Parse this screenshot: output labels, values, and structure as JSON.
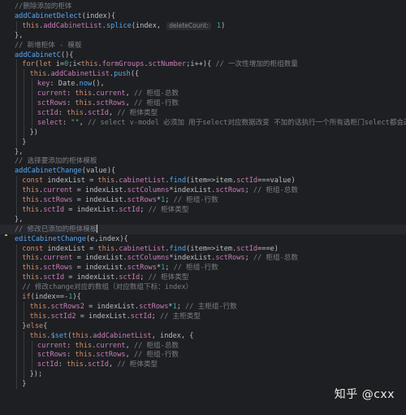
{
  "lines": [
    {
      "indent": 1,
      "tokens": [
        {
          "t": "//删除添加的柜体",
          "c": "cm"
        }
      ]
    },
    {
      "indent": 1,
      "tokens": [
        {
          "t": "addCabinetDelect",
          "c": "fn"
        },
        {
          "t": "(index){",
          "c": "plain"
        }
      ]
    },
    {
      "indent": 2,
      "tokens": [
        {
          "t": "this",
          "c": "kw"
        },
        {
          "t": ".",
          "c": "plain"
        },
        {
          "t": "addCabinetList",
          "c": "prop"
        },
        {
          "t": ".",
          "c": "plain"
        },
        {
          "t": "splice",
          "c": "fn"
        },
        {
          "t": "(index, ",
          "c": "plain"
        },
        {
          "t": "deleteCount:",
          "c": "hint"
        },
        {
          "t": " 1",
          "c": "num"
        },
        {
          "t": ")",
          "c": "plain"
        }
      ]
    },
    {
      "indent": 1,
      "tokens": [
        {
          "t": "},",
          "c": "plain"
        }
      ]
    },
    {
      "indent": 1,
      "tokens": [
        {
          "t": "// 新增柜体 - 模板",
          "c": "cm"
        }
      ]
    },
    {
      "indent": 1,
      "tokens": [
        {
          "t": "addCabinetC",
          "c": "fn"
        },
        {
          "t": "(){",
          "c": "plain"
        }
      ]
    },
    {
      "indent": 2,
      "tokens": [
        {
          "t": "for",
          "c": "kw"
        },
        {
          "t": "(",
          "c": "plain"
        },
        {
          "t": "let ",
          "c": "kw"
        },
        {
          "t": "i=",
          "c": "plain"
        },
        {
          "t": "0",
          "c": "num"
        },
        {
          "t": ";i<",
          "c": "plain"
        },
        {
          "t": "this",
          "c": "kw"
        },
        {
          "t": ".",
          "c": "plain"
        },
        {
          "t": "formGroups",
          "c": "prop"
        },
        {
          "t": ".",
          "c": "plain"
        },
        {
          "t": "sctNumber",
          "c": "prop"
        },
        {
          "t": ";i++){ ",
          "c": "plain"
        },
        {
          "t": "// 一次性增加的柜组数量",
          "c": "cm"
        }
      ]
    },
    {
      "indent": 3,
      "tokens": [
        {
          "t": "this",
          "c": "kw"
        },
        {
          "t": ".",
          "c": "plain"
        },
        {
          "t": "addCabinetList",
          "c": "prop"
        },
        {
          "t": ".",
          "c": "plain"
        },
        {
          "t": "push",
          "c": "fn"
        },
        {
          "t": "({",
          "c": "plain"
        }
      ]
    },
    {
      "indent": 4,
      "tokens": [
        {
          "t": "key",
          "c": "prop"
        },
        {
          "t": ": Date.",
          "c": "plain"
        },
        {
          "t": "now",
          "c": "fn"
        },
        {
          "t": "(),",
          "c": "plain"
        }
      ]
    },
    {
      "indent": 4,
      "tokens": [
        {
          "t": "current",
          "c": "prop"
        },
        {
          "t": ": ",
          "c": "plain"
        },
        {
          "t": "this",
          "c": "kw"
        },
        {
          "t": ".",
          "c": "plain"
        },
        {
          "t": "current",
          "c": "prop"
        },
        {
          "t": ", ",
          "c": "plain"
        },
        {
          "t": "// 柜组-总数",
          "c": "cm"
        }
      ]
    },
    {
      "indent": 4,
      "tokens": [
        {
          "t": "sctRows",
          "c": "prop"
        },
        {
          "t": ": ",
          "c": "plain"
        },
        {
          "t": "this",
          "c": "kw"
        },
        {
          "t": ".",
          "c": "plain"
        },
        {
          "t": "sctRows",
          "c": "prop"
        },
        {
          "t": ", ",
          "c": "plain"
        },
        {
          "t": "// 柜组-行数",
          "c": "cm"
        }
      ]
    },
    {
      "indent": 4,
      "tokens": [
        {
          "t": "sctId",
          "c": "prop"
        },
        {
          "t": ": ",
          "c": "plain"
        },
        {
          "t": "this",
          "c": "kw"
        },
        {
          "t": ".",
          "c": "plain"
        },
        {
          "t": "sctId",
          "c": "prop"
        },
        {
          "t": ", ",
          "c": "plain"
        },
        {
          "t": "// 柜体类型",
          "c": "cm"
        }
      ]
    },
    {
      "indent": 4,
      "tokens": [
        {
          "t": "select",
          "c": "prop"
        },
        {
          "t": ": ",
          "c": "plain"
        },
        {
          "t": "\"\"",
          "c": "str"
        },
        {
          "t": ", ",
          "c": "plain"
        },
        {
          "t": "// select v-model 必须加 用于select对应数据改变 不加的话执行一个所有选柜门select都会改变",
          "c": "cm"
        }
      ]
    },
    {
      "indent": 3,
      "tokens": [
        {
          "t": "})",
          "c": "plain"
        }
      ]
    },
    {
      "indent": 2,
      "tokens": [
        {
          "t": "}",
          "c": "plain"
        }
      ]
    },
    {
      "indent": 1,
      "tokens": [
        {
          "t": "},",
          "c": "plain"
        }
      ]
    },
    {
      "indent": 1,
      "tokens": [
        {
          "t": "// 选择要添加的柜体模板",
          "c": "cm"
        }
      ]
    },
    {
      "indent": 1,
      "tokens": [
        {
          "t": "addCabinetChange",
          "c": "fn"
        },
        {
          "t": "(value){",
          "c": "plain"
        }
      ]
    },
    {
      "indent": 2,
      "tokens": [
        {
          "t": "const ",
          "c": "kw"
        },
        {
          "t": "indexList = ",
          "c": "plain"
        },
        {
          "t": "this",
          "c": "kw"
        },
        {
          "t": ".",
          "c": "plain"
        },
        {
          "t": "cabinetList",
          "c": "prop"
        },
        {
          "t": ".",
          "c": "plain"
        },
        {
          "t": "find",
          "c": "fn"
        },
        {
          "t": "(item=>item.",
          "c": "plain"
        },
        {
          "t": "sctId",
          "c": "prop"
        },
        {
          "t": "===value)",
          "c": "plain"
        }
      ]
    },
    {
      "indent": 2,
      "tokens": [
        {
          "t": "this",
          "c": "kw"
        },
        {
          "t": ".",
          "c": "plain"
        },
        {
          "t": "current",
          "c": "prop"
        },
        {
          "t": " = indexList.",
          "c": "plain"
        },
        {
          "t": "sctColumns",
          "c": "prop"
        },
        {
          "t": "*indexList.",
          "c": "plain"
        },
        {
          "t": "sctRows",
          "c": "prop"
        },
        {
          "t": "; ",
          "c": "plain"
        },
        {
          "t": "// 柜组-总数",
          "c": "cm"
        }
      ]
    },
    {
      "indent": 2,
      "tokens": [
        {
          "t": "this",
          "c": "kw"
        },
        {
          "t": ".",
          "c": "plain"
        },
        {
          "t": "sctRows",
          "c": "prop"
        },
        {
          "t": " = indexList.",
          "c": "plain"
        },
        {
          "t": "sctRows",
          "c": "prop"
        },
        {
          "t": "*",
          "c": "plain"
        },
        {
          "t": "1",
          "c": "num"
        },
        {
          "t": "; ",
          "c": "plain"
        },
        {
          "t": "// 柜组-行数",
          "c": "cm"
        }
      ]
    },
    {
      "indent": 2,
      "tokens": [
        {
          "t": "this",
          "c": "kw"
        },
        {
          "t": ".",
          "c": "plain"
        },
        {
          "t": "sctId",
          "c": "prop"
        },
        {
          "t": " = indexList.",
          "c": "plain"
        },
        {
          "t": "sctId",
          "c": "prop"
        },
        {
          "t": "; ",
          "c": "plain"
        },
        {
          "t": "// 柜体类型",
          "c": "cm"
        }
      ]
    },
    {
      "indent": 1,
      "tokens": [
        {
          "t": "},",
          "c": "plain"
        }
      ]
    },
    {
      "indent": 1,
      "hl": true,
      "caret": true,
      "tokens": [
        {
          "t": "// 修改已添加的柜体模板",
          "c": "cm"
        }
      ]
    },
    {
      "indent": 1,
      "tokens": [
        {
          "t": "editCabinetChange",
          "c": "fn"
        },
        {
          "t": "(e,index){",
          "c": "plain"
        }
      ]
    },
    {
      "indent": 2,
      "tokens": [
        {
          "t": "const ",
          "c": "kw"
        },
        {
          "t": "indexList = ",
          "c": "plain"
        },
        {
          "t": "this",
          "c": "kw"
        },
        {
          "t": ".",
          "c": "plain"
        },
        {
          "t": "cabinetList",
          "c": "prop"
        },
        {
          "t": ".",
          "c": "plain"
        },
        {
          "t": "find",
          "c": "fn"
        },
        {
          "t": "(item=>item.",
          "c": "plain"
        },
        {
          "t": "sctId",
          "c": "prop"
        },
        {
          "t": "===e)",
          "c": "plain"
        }
      ]
    },
    {
      "indent": 2,
      "tokens": [
        {
          "t": "this",
          "c": "kw"
        },
        {
          "t": ".",
          "c": "plain"
        },
        {
          "t": "current",
          "c": "prop"
        },
        {
          "t": " = indexList.",
          "c": "plain"
        },
        {
          "t": "sctColumns",
          "c": "prop"
        },
        {
          "t": "*indexList.",
          "c": "plain"
        },
        {
          "t": "sctRows",
          "c": "prop"
        },
        {
          "t": "; ",
          "c": "plain"
        },
        {
          "t": "// 柜组-总数",
          "c": "cm"
        }
      ]
    },
    {
      "indent": 2,
      "tokens": [
        {
          "t": "this",
          "c": "kw"
        },
        {
          "t": ".",
          "c": "plain"
        },
        {
          "t": "sctRows",
          "c": "prop"
        },
        {
          "t": " = indexList.",
          "c": "plain"
        },
        {
          "t": "sctRows",
          "c": "prop"
        },
        {
          "t": "*",
          "c": "plain"
        },
        {
          "t": "1",
          "c": "num"
        },
        {
          "t": "; ",
          "c": "plain"
        },
        {
          "t": "// 柜组-行数",
          "c": "cm"
        }
      ]
    },
    {
      "indent": 2,
      "tokens": [
        {
          "t": "this",
          "c": "kw"
        },
        {
          "t": ".",
          "c": "plain"
        },
        {
          "t": "sctId",
          "c": "prop"
        },
        {
          "t": " = indexList.",
          "c": "plain"
        },
        {
          "t": "sctId",
          "c": "prop"
        },
        {
          "t": "; ",
          "c": "plain"
        },
        {
          "t": "// 柜体类型",
          "c": "cm"
        }
      ]
    },
    {
      "indent": 2,
      "tokens": [
        {
          "t": "// 修改change对应的数组（对应数组下标：index）",
          "c": "cm"
        }
      ]
    },
    {
      "indent": 2,
      "tokens": [
        {
          "t": "if",
          "c": "kw"
        },
        {
          "t": "(index==-",
          "c": "plain"
        },
        {
          "t": "1",
          "c": "num"
        },
        {
          "t": "){",
          "c": "plain"
        }
      ]
    },
    {
      "indent": 3,
      "tokens": [
        {
          "t": "this",
          "c": "kw"
        },
        {
          "t": ".",
          "c": "plain"
        },
        {
          "t": "sctRows2",
          "c": "prop"
        },
        {
          "t": " = indexList.",
          "c": "plain"
        },
        {
          "t": "sctRows",
          "c": "prop"
        },
        {
          "t": "*",
          "c": "plain"
        },
        {
          "t": "1",
          "c": "num"
        },
        {
          "t": "; ",
          "c": "plain"
        },
        {
          "t": "// 主柜组-行数",
          "c": "cm"
        }
      ]
    },
    {
      "indent": 3,
      "tokens": [
        {
          "t": "this",
          "c": "kw"
        },
        {
          "t": ".",
          "c": "plain"
        },
        {
          "t": "sctId2",
          "c": "prop"
        },
        {
          "t": " = indexList.",
          "c": "plain"
        },
        {
          "t": "sctId",
          "c": "prop"
        },
        {
          "t": "; ",
          "c": "plain"
        },
        {
          "t": "// 主柜类型",
          "c": "cm"
        }
      ]
    },
    {
      "indent": 2,
      "tokens": [
        {
          "t": "}",
          "c": "plain"
        },
        {
          "t": "else",
          "c": "kw"
        },
        {
          "t": "{",
          "c": "plain"
        }
      ]
    },
    {
      "indent": 3,
      "tokens": [
        {
          "t": "this",
          "c": "kw"
        },
        {
          "t": ".",
          "c": "plain"
        },
        {
          "t": "$set",
          "c": "fn"
        },
        {
          "t": "(",
          "c": "plain"
        },
        {
          "t": "this",
          "c": "kw"
        },
        {
          "t": ".",
          "c": "plain"
        },
        {
          "t": "addCabinetList",
          "c": "prop"
        },
        {
          "t": ", index, {",
          "c": "plain"
        }
      ]
    },
    {
      "indent": 4,
      "tokens": [
        {
          "t": "current",
          "c": "prop"
        },
        {
          "t": ": ",
          "c": "plain"
        },
        {
          "t": "this",
          "c": "kw"
        },
        {
          "t": ".",
          "c": "plain"
        },
        {
          "t": "current",
          "c": "prop"
        },
        {
          "t": ", ",
          "c": "plain"
        },
        {
          "t": "// 柜组-总数",
          "c": "cm"
        }
      ]
    },
    {
      "indent": 4,
      "tokens": [
        {
          "t": "sctRows",
          "c": "prop"
        },
        {
          "t": ": ",
          "c": "plain"
        },
        {
          "t": "this",
          "c": "kw"
        },
        {
          "t": ".",
          "c": "plain"
        },
        {
          "t": "sctRows",
          "c": "prop"
        },
        {
          "t": ", ",
          "c": "plain"
        },
        {
          "t": "// 柜组-行数",
          "c": "cm"
        }
      ]
    },
    {
      "indent": 4,
      "tokens": [
        {
          "t": "sctId",
          "c": "prop"
        },
        {
          "t": ": ",
          "c": "plain"
        },
        {
          "t": "this",
          "c": "kw"
        },
        {
          "t": ".",
          "c": "plain"
        },
        {
          "t": "sctId",
          "c": "prop"
        },
        {
          "t": ", ",
          "c": "plain"
        },
        {
          "t": "// 柜体类型",
          "c": "cm"
        }
      ]
    },
    {
      "indent": 3,
      "tokens": [
        {
          "t": "});",
          "c": "plain"
        }
      ]
    },
    {
      "indent": 2,
      "tokens": [
        {
          "t": "}",
          "c": "plain"
        }
      ]
    }
  ],
  "watermark": "知乎 @cxx",
  "colors": {
    "background": "#1e1f22",
    "keyword": "#cf8e6d",
    "function": "#56a8f5",
    "property": "#c77dbb",
    "string": "#6aab73",
    "number": "#2aacb8",
    "comment": "#7a7e85",
    "text": "#bcbec4"
  },
  "icons": {
    "gutter_hint": "lightbulb-icon"
  }
}
